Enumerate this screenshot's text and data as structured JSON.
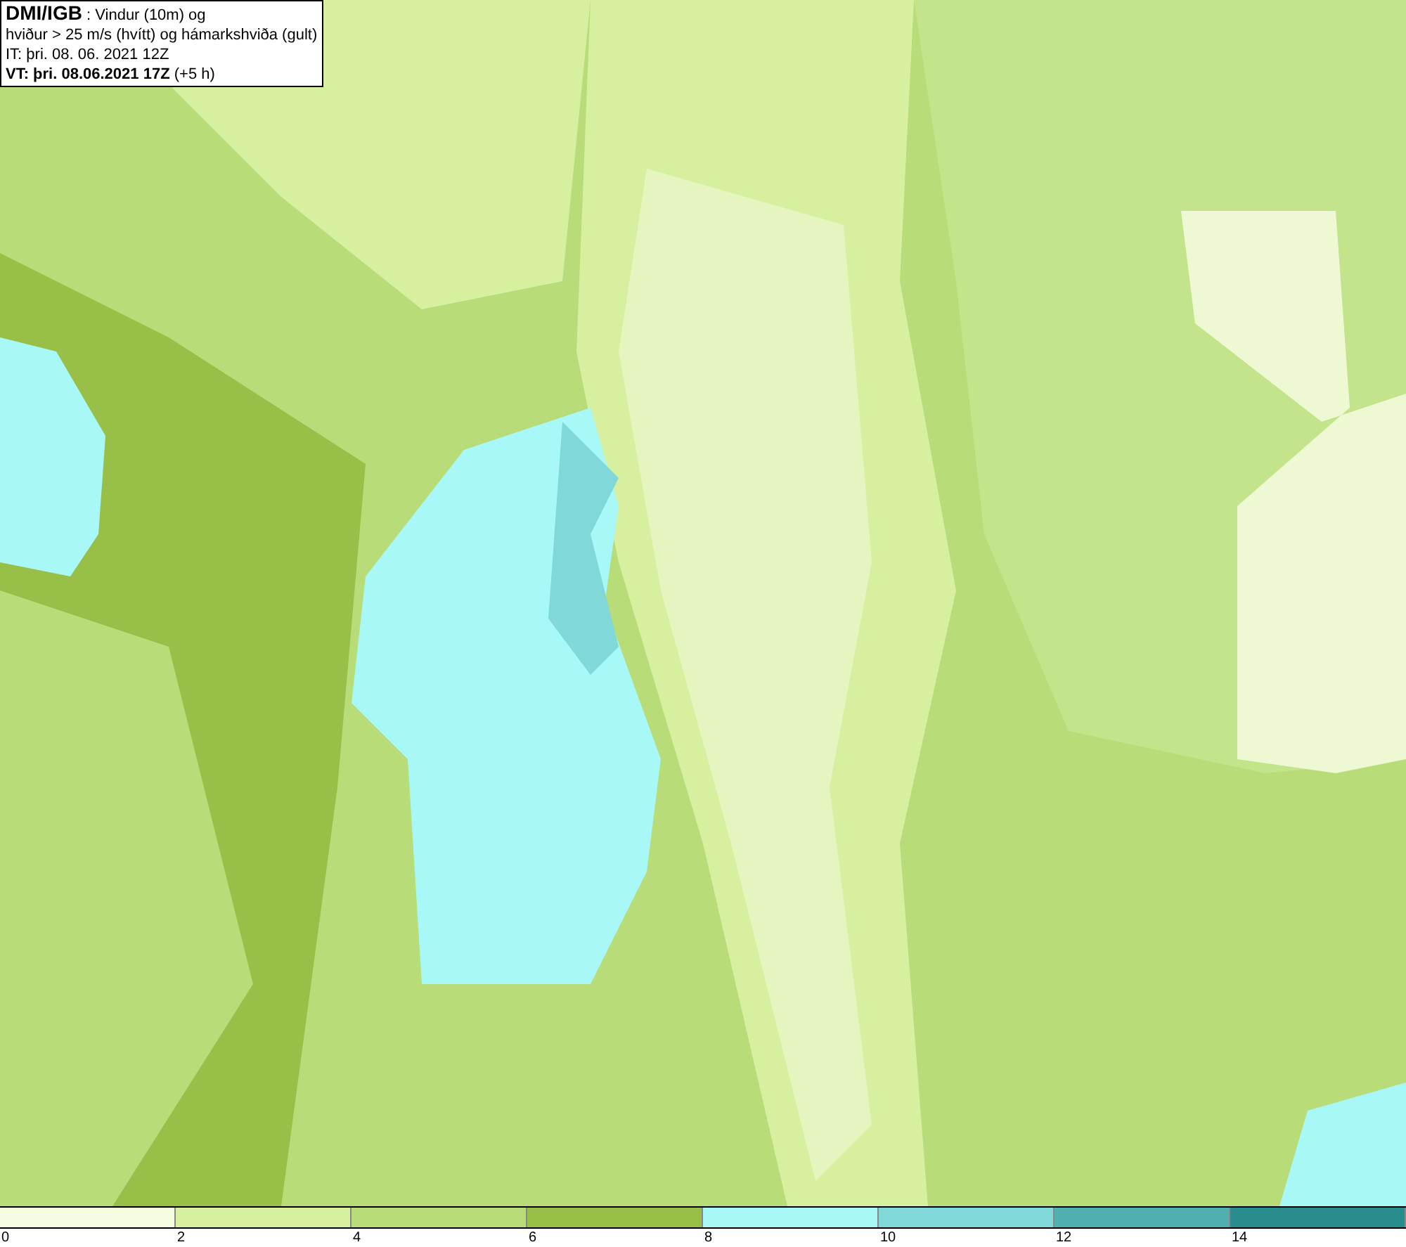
{
  "info_box": {
    "lines": [
      "**DMI/IGB** : Vindur (10m) og",
      "hviður > 25 m/s (hvítt) og hámarkshviða (gult)",
      "IT: þri. 08. 06. 2021 12Z",
      "**VT: þri. 08.06.2021 17Z** (+5 h)"
    ]
  },
  "legend": {
    "bins": [
      {
        "color": "#f4fde0"
      },
      {
        "color": "#d6f0a0"
      },
      {
        "color": "#b8dc78"
      },
      {
        "color": "#98c048"
      },
      {
        "color": "#a8f8f8"
      },
      {
        "color": "#80d8d8"
      },
      {
        "color": "#50b0b0"
      },
      {
        "color": "#288c8c"
      }
    ],
    "ticks": [
      "0",
      "2",
      "4",
      "6",
      "8",
      "10",
      "12",
      "14"
    ]
  }
}
